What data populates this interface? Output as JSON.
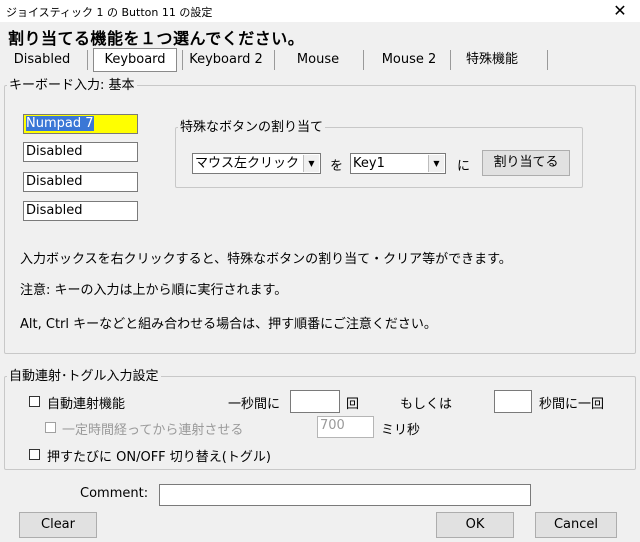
{
  "window": {
    "title": "ジョイスティック 1 の Button 11 の設定",
    "close_glyph": "✕"
  },
  "heading": "割り当てる機能を１つ選んでください。",
  "tabs": [
    {
      "label": "Disabled",
      "selected": false
    },
    {
      "label": "Keyboard",
      "selected": true
    },
    {
      "label": "Keyboard 2",
      "selected": false
    },
    {
      "label": "Mouse",
      "selected": false
    },
    {
      "label": "Mouse 2",
      "selected": false
    },
    {
      "label": "特殊機能",
      "selected": false
    }
  ],
  "keyboard_group": {
    "legend": "キーボード入力: 基本",
    "key_inputs": [
      "Numpad 7",
      "Disabled",
      "Disabled",
      "Disabled"
    ],
    "special": {
      "legend": "特殊なボタンの割り当て",
      "mouse_select": "マウス左クリック",
      "wo_text": "を",
      "key_select": "Key1",
      "ni_text": "に",
      "assign_button": "割り当てる"
    },
    "notes": [
      "入力ボックスを右クリックすると、特殊なボタンの割り当て・クリア等ができます。",
      "注意: キーの入力は上から順に実行されます。",
      "Alt, Ctrl キーなどと組み合わせる場合は、押す順番にご注意ください。"
    ]
  },
  "auto_group": {
    "legend": "自動連射･トグル入力設定",
    "auto_fire_label": "自動連射機能",
    "per_second_label": "一秒間に",
    "per_second_value": "",
    "times_label": "回",
    "or_label": "もしくは",
    "seconds_value": "",
    "per_seconds_label": "秒間に一回",
    "delay_label": "一定時間経ってから連射させる",
    "delay_value": "700",
    "ms_label": "ミリ秒",
    "toggle_label": "押すたびに ON/OFF 切り替え(トグル)"
  },
  "comment": {
    "label": "Comment:",
    "value": ""
  },
  "buttons": {
    "clear": "Clear",
    "ok": "OK",
    "cancel": "Cancel"
  },
  "colors": {
    "highlight": "#ffff00",
    "selection": "#3a77d6",
    "window_bg": "#f0f0f0"
  }
}
